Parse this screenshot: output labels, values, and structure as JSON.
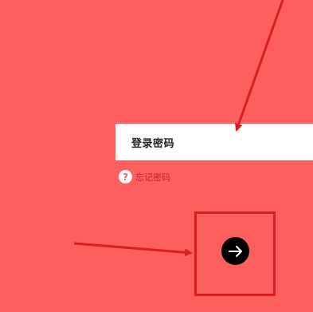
{
  "password": {
    "placeholder": "登录密码"
  },
  "forgot": {
    "icon": "?",
    "label": "忘记密码"
  },
  "next_button": {
    "icon": "arrow-right-icon"
  },
  "colors": {
    "background": "#fd5f5f",
    "annotation": "#d81f1f"
  }
}
